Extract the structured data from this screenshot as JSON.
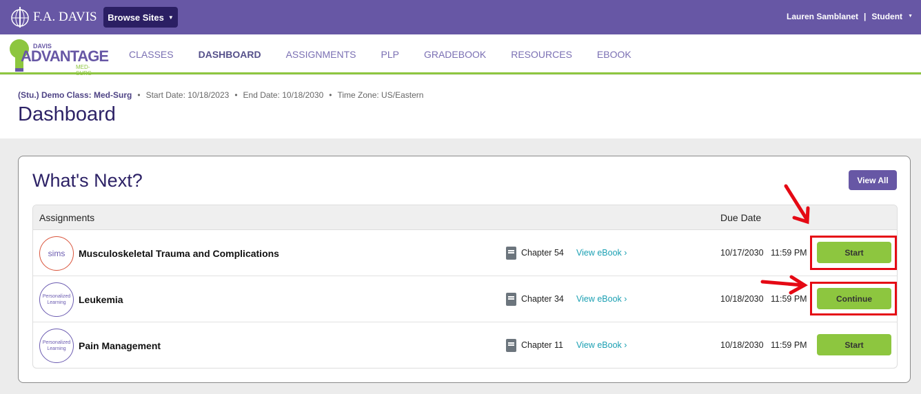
{
  "topbar": {
    "brand": "F.A. DAVIS",
    "browse_label": "Browse Sites",
    "user_name": "Lauren Samblanet",
    "separator": "|",
    "role": "Student"
  },
  "logo": {
    "top": "DAVIS",
    "main": "ADVANTAGE",
    "sub": "MED-SURG"
  },
  "nav": [
    "CLASSES",
    "DASHBOARD",
    "ASSIGNMENTS",
    "PLP",
    "GRADEBOOK",
    "RESOURCES",
    "EBOOK"
  ],
  "header": {
    "class_name": "(Stu.) Demo Class: Med-Surg",
    "start": "Start Date: 10/18/2023",
    "end": "End Date: 10/18/2030",
    "tz": "Time Zone: US/Eastern",
    "bullet": "•",
    "title": "Dashboard"
  },
  "card": {
    "title": "What's Next?",
    "view_all": "View All",
    "col_assignments": "Assignments",
    "col_due": "Due Date"
  },
  "rows": [
    {
      "badge": "sims",
      "title": "Musculoskeletal Trauma and Complications",
      "chapter": "Chapter 54",
      "ebook": "View eBook ›",
      "date": "10/17/2030",
      "time": "11:59 PM",
      "action": "Start"
    },
    {
      "badge": "Personalized Learning",
      "title": "Leukemia",
      "chapter": "Chapter 34",
      "ebook": "View eBook ›",
      "date": "10/18/2030",
      "time": "11:59 PM",
      "action": "Continue"
    },
    {
      "badge": "Personalized Learning",
      "title": "Pain Management",
      "chapter": "Chapter 11",
      "ebook": "View eBook ›",
      "date": "10/18/2030",
      "time": "11:59 PM",
      "action": "Start"
    }
  ],
  "colors": {
    "purple": "#6757a5",
    "green": "#8dc63f",
    "annotation": "#e50914"
  }
}
